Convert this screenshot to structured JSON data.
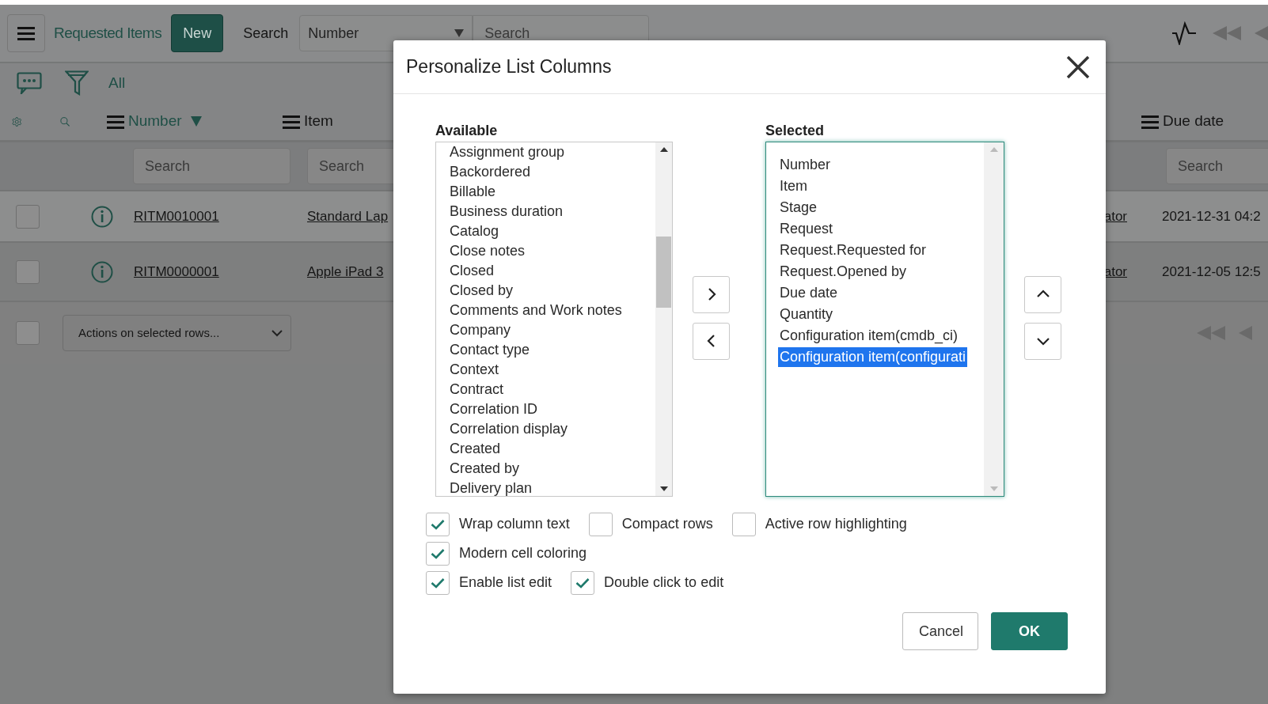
{
  "header": {
    "title": "Requested Items",
    "new_button": "New",
    "search_label": "Search",
    "search_field": {
      "value": "Number"
    },
    "search_input": {
      "placeholder": "Search"
    }
  },
  "filter_bar": {
    "label": "All"
  },
  "columns": [
    {
      "label": "Number",
      "sorted": true
    },
    {
      "label": "Item",
      "sorted": false
    },
    {
      "label": "Due date",
      "sorted": false
    }
  ],
  "column_search": [
    {
      "placeholder": "Search"
    },
    {
      "placeholder": "Search"
    },
    {
      "placeholder": "Search"
    }
  ],
  "rows": [
    {
      "checked": false,
      "number": "RITM0010001",
      "item": "Standard Lap",
      "column_3": "ator",
      "due_date": "2021-12-31 04:2"
    },
    {
      "checked": false,
      "number": "RITM0000001",
      "item": "Apple iPad 3",
      "column_3": "ator",
      "due_date": "2021-12-05 12:5"
    }
  ],
  "footer": {
    "checked": false,
    "actions": {
      "value": "Actions on selected rows..."
    }
  },
  "dialog": {
    "title": "Personalize List Columns",
    "available": {
      "label": "Available",
      "items": [
        "Assignment group",
        "Backordered",
        "Billable",
        "Business duration",
        "Catalog",
        "Close notes",
        "Closed",
        "Closed by",
        "Comments and Work notes",
        "Company",
        "Contact type",
        "Context",
        "Contract",
        "Correlation ID",
        "Correlation display",
        "Created",
        "Created by",
        "Delivery plan"
      ]
    },
    "selected": {
      "label": "Selected",
      "items": [
        {
          "label": "Number",
          "selected": false
        },
        {
          "label": "Item",
          "selected": false
        },
        {
          "label": "Stage",
          "selected": false
        },
        {
          "label": "Request",
          "selected": false
        },
        {
          "label": "Request.Requested for",
          "selected": false
        },
        {
          "label": "Request.Opened by",
          "selected": false
        },
        {
          "label": "Due date",
          "selected": false
        },
        {
          "label": "Quantity",
          "selected": false
        },
        {
          "label": "Configuration item(cmdb_ci)",
          "selected": false
        },
        {
          "label": "Configuration item(configurati",
          "selected": true
        }
      ]
    },
    "option_rows": [
      {
        "options": [
          {
            "label": "Wrap column text",
            "checked": true
          },
          {
            "label": "Compact rows",
            "checked": false
          },
          {
            "label": "Active row highlighting",
            "checked": false
          }
        ]
      },
      {
        "options": [
          {
            "label": "Modern cell coloring",
            "checked": true
          }
        ]
      },
      {
        "options": [
          {
            "label": "Enable list edit",
            "checked": true
          },
          {
            "label": "Double click to edit",
            "checked": true
          }
        ]
      }
    ],
    "buttons": [
      {
        "label": "Cancel",
        "kind": "secondary"
      },
      {
        "label": "OK",
        "kind": "primary"
      }
    ]
  }
}
